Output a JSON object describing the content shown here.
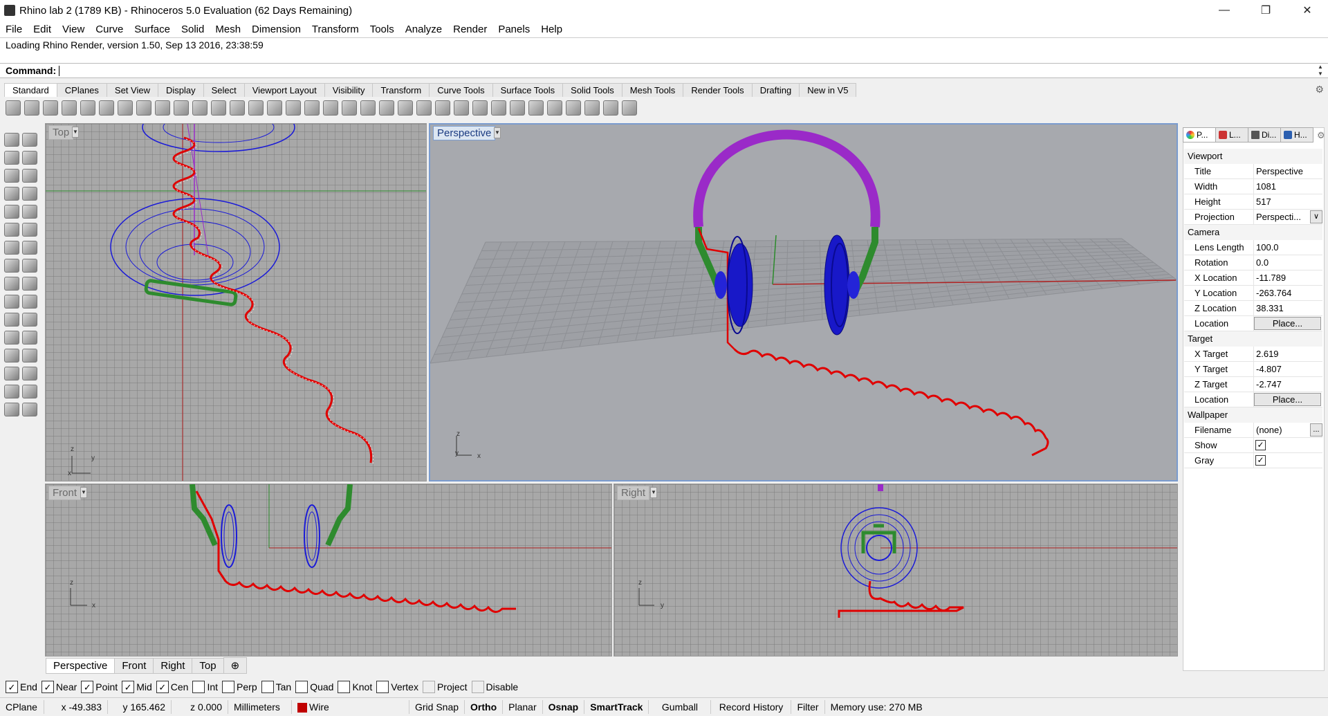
{
  "window": {
    "title": "Rhino lab 2 (1789 KB) - Rhinoceros 5.0 Evaluation (62 Days Remaining)",
    "minimize": "—",
    "maximize": "❐",
    "close": "✕"
  },
  "menu": [
    "File",
    "Edit",
    "View",
    "Curve",
    "Surface",
    "Solid",
    "Mesh",
    "Dimension",
    "Transform",
    "Tools",
    "Analyze",
    "Render",
    "Panels",
    "Help"
  ],
  "history": "Loading Rhino Render, version 1.50, Sep 13 2016, 23:38:59",
  "command": {
    "label": "Command:",
    "value": ""
  },
  "toolbar_tabs": [
    "Standard",
    "CPlanes",
    "Set View",
    "Display",
    "Select",
    "Viewport Layout",
    "Visibility",
    "Transform",
    "Curve Tools",
    "Surface Tools",
    "Solid Tools",
    "Mesh Tools",
    "Render Tools",
    "Drafting",
    "New in V5"
  ],
  "toolbar_icon_count": 34,
  "viewports": {
    "top": {
      "label": "Top",
      "axis_z": "z",
      "axis_x": "x",
      "axis_y": "y"
    },
    "perspective": {
      "label": "Perspective",
      "axis_z": "z",
      "axis_y": "y",
      "axis_x": "x"
    },
    "front": {
      "label": "Front",
      "axis_z": "z",
      "axis_x": "x"
    },
    "right": {
      "label": "Right",
      "axis_z": "z",
      "axis_y": "y"
    }
  },
  "viewport_tabs": [
    "Perspective",
    "Front",
    "Right",
    "Top",
    "⊕"
  ],
  "osnaps": [
    {
      "label": "End",
      "checked": true
    },
    {
      "label": "Near",
      "checked": true
    },
    {
      "label": "Point",
      "checked": true
    },
    {
      "label": "Mid",
      "checked": true
    },
    {
      "label": "Cen",
      "checked": true
    },
    {
      "label": "Int",
      "checked": false
    },
    {
      "label": "Perp",
      "checked": false
    },
    {
      "label": "Tan",
      "checked": false
    },
    {
      "label": "Quad",
      "checked": false
    },
    {
      "label": "Knot",
      "checked": false
    },
    {
      "label": "Vertex",
      "checked": false
    },
    {
      "label": "Project",
      "checked": false
    },
    {
      "label": "Disable",
      "checked": false
    }
  ],
  "status": {
    "cplane": "CPlane",
    "x": "x -49.383",
    "y": "y 165.462",
    "z": "z 0.000",
    "units": "Millimeters",
    "layer": "Wire",
    "layer_color": "#c00000",
    "grid_snap": "Grid Snap",
    "ortho": "Ortho",
    "planar": "Planar",
    "osnap": "Osnap",
    "smarttrack": "SmartTrack",
    "gumball": "Gumball",
    "record_history": "Record History",
    "filter": "Filter",
    "memory": "Memory use: 270 MB"
  },
  "panel": {
    "tabs": [
      "P...",
      "L...",
      "Di...",
      "H..."
    ],
    "sections": [
      {
        "title": "Viewport",
        "rows": [
          {
            "key": "Title",
            "value": "Perspective"
          },
          {
            "key": "Width",
            "value": "1081"
          },
          {
            "key": "Height",
            "value": "517"
          },
          {
            "key": "Projection",
            "value": "Perspecti..."
          }
        ]
      },
      {
        "title": "Camera",
        "rows": [
          {
            "key": "Lens Length",
            "value": "100.0"
          },
          {
            "key": "Rotation",
            "value": "0.0"
          },
          {
            "key": "X Location",
            "value": "-11.789"
          },
          {
            "key": "Y Location",
            "value": "-263.764"
          },
          {
            "key": "Z Location",
            "value": "38.331"
          },
          {
            "key": "Location",
            "value": "Place..."
          }
        ]
      },
      {
        "title": "Target",
        "rows": [
          {
            "key": "X Target",
            "value": "2.619"
          },
          {
            "key": "Y Target",
            "value": "-4.807"
          },
          {
            "key": "Z Target",
            "value": "-2.747"
          },
          {
            "key": "Location",
            "value": "Place..."
          }
        ]
      },
      {
        "title": "Wallpaper",
        "rows": [
          {
            "key": "Filename",
            "value": "(none)"
          },
          {
            "key": "Show",
            "value": "✓"
          },
          {
            "key": "Gray",
            "value": "✓"
          }
        ]
      }
    ],
    "projection_dropdown": "∨",
    "filename_browse": "..."
  },
  "colors": {
    "curve": "#e00000",
    "surface": "#1a1ad8",
    "band": "#9a2ac8",
    "slider": "#2e8b2e"
  }
}
